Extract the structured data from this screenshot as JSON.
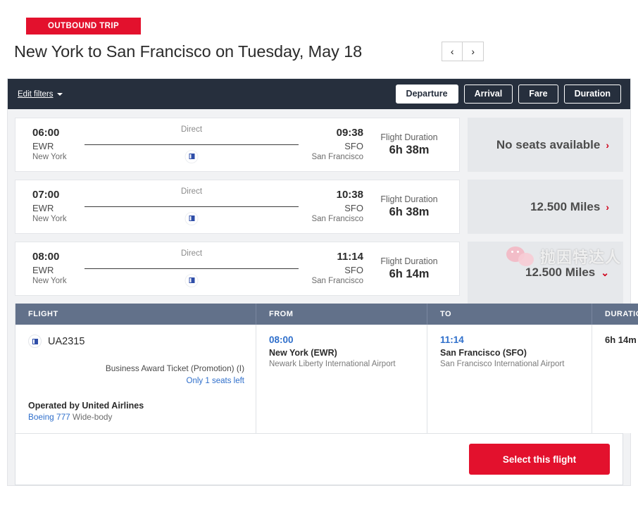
{
  "header": {
    "badge": "OUTBOUND TRIP",
    "title": "New York to San Francisco on Tuesday, May 18",
    "prev_icon": "‹",
    "next_icon": "›"
  },
  "filter_bar": {
    "edit_filters": "Edit filters",
    "sort_buttons": [
      {
        "label": "Departure",
        "active": true
      },
      {
        "label": "Arrival",
        "active": false
      },
      {
        "label": "Fare",
        "active": false
      },
      {
        "label": "Duration",
        "active": false
      }
    ]
  },
  "flights": [
    {
      "depart_time": "06:00",
      "depart_code": "EWR",
      "depart_city": "New York",
      "stops": "Direct",
      "arrive_time": "09:38",
      "arrive_code": "SFO",
      "arrive_city": "San Francisco",
      "duration_label": "Flight Duration",
      "duration_value": "6h 38m",
      "price": "No seats available",
      "chevron": "›"
    },
    {
      "depart_time": "07:00",
      "depart_code": "EWR",
      "depart_city": "New York",
      "stops": "Direct",
      "arrive_time": "10:38",
      "arrive_code": "SFO",
      "arrive_city": "San Francisco",
      "duration_label": "Flight Duration",
      "duration_value": "6h 38m",
      "price": "12.500 Miles",
      "chevron": "›"
    },
    {
      "depart_time": "08:00",
      "depart_code": "EWR",
      "depart_city": "New York",
      "stops": "Direct",
      "arrive_time": "11:14",
      "arrive_code": "SFO",
      "arrive_city": "San Francisco",
      "duration_label": "Flight Duration",
      "duration_value": "6h 14m",
      "price": "12.500 Miles",
      "chevron": "⌄"
    }
  ],
  "detail": {
    "columns": {
      "flight": "FLIGHT",
      "from": "FROM",
      "to": "TO",
      "duration": "DURATION"
    },
    "flight_number": "UA2315",
    "fare_name": "Business Award Ticket (Promotion) (I)",
    "seats_left": "Only 1 seats left",
    "operated_by": "Operated by United Airlines",
    "aircraft_link": "Boeing 777",
    "aircraft_suffix": " Wide-body",
    "from": {
      "time": "08:00",
      "city": "New York (EWR)",
      "airport": "Newark Liberty International Airport"
    },
    "to": {
      "time": "11:14",
      "city": "San Francisco (SFO)",
      "airport": "San Francisco International Airport"
    },
    "duration": "6h 14m",
    "select_button": "Select this flight"
  },
  "watermark": {
    "text": "抛因特达人"
  },
  "colors": {
    "brand_red": "#E3112D",
    "filter_bar": "#262F3D",
    "table_header": "#62718A",
    "price_panel": "#E6E8EB",
    "link_blue": "#2F6FCB"
  }
}
